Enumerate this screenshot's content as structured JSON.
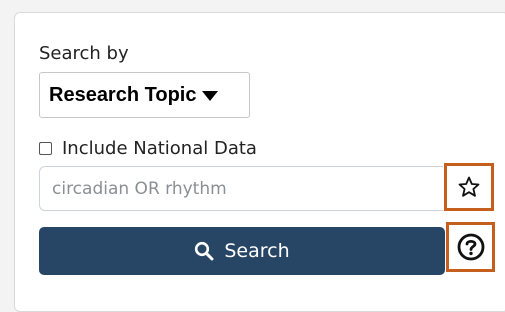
{
  "search_form": {
    "search_by_label": "Search by",
    "search_by_selected": "Research Topic",
    "include_national_label": "Include National Data",
    "include_national_checked": false,
    "query_placeholder": "circadian OR rhythm",
    "search_button_label": "Search"
  },
  "icons": {
    "dropdown": "chevron-down-icon",
    "favorite": "star-icon",
    "search": "search-icon",
    "help": "help-circle-icon"
  },
  "colors": {
    "primary_button": "#274565",
    "highlight_border": "#c65f1e"
  }
}
